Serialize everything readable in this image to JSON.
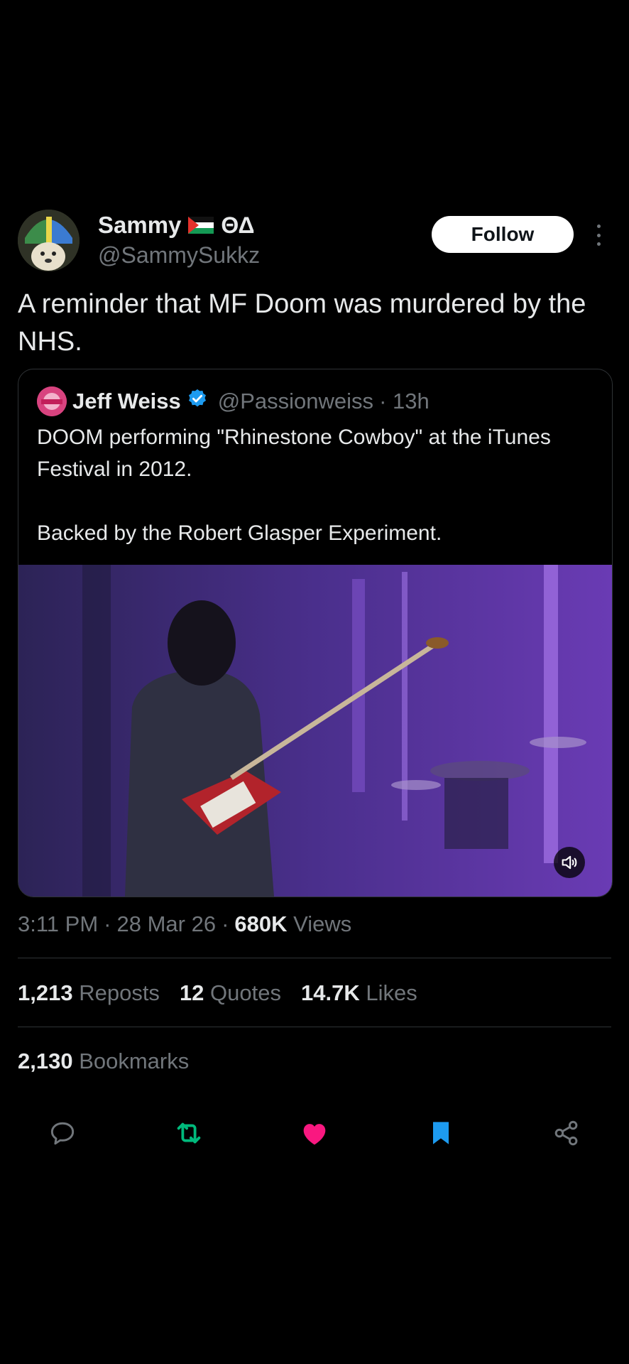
{
  "author": {
    "name": "Sammy",
    "extra": "ΘΔ",
    "handle": "@SammySukkz",
    "follow_label": "Follow"
  },
  "tweet": {
    "text": "A reminder that MF Doom was murdered by the NHS."
  },
  "quote": {
    "name": "Jeff Weiss",
    "handle": "@Passionweiss",
    "time": "· 13h",
    "line1": "DOOM performing \"Rhinestone Cowboy\" at the iTunes Festival in 2012.",
    "line2": "Backed by the Robert Glasper Experiment."
  },
  "meta": {
    "time": "3:11 PM",
    "sep1": "·",
    "date": "28 Mar 26",
    "sep2": "·",
    "views_count": "680K",
    "views_label": "Views"
  },
  "stats": {
    "reposts_count": "1,213",
    "reposts_label": "Reposts",
    "quotes_count": "12",
    "quotes_label": "Quotes",
    "likes_count": "14.7K",
    "likes_label": "Likes",
    "bookmarks_count": "2,130",
    "bookmarks_label": "Bookmarks"
  },
  "icons": {
    "reply": "reply-icon",
    "repost": "repost-icon",
    "like": "heart-icon",
    "bookmark": "bookmark-icon",
    "share": "share-icon",
    "verified": "verified-badge-icon",
    "mute": "volume-icon"
  },
  "colors": {
    "background": "#000000",
    "text": "#e7e9ea",
    "muted": "#71767b",
    "repost_active": "#00ba7c",
    "like_active": "#f91880",
    "bookmark_active": "#1d9bf0",
    "verified": "#1d9bf0"
  }
}
